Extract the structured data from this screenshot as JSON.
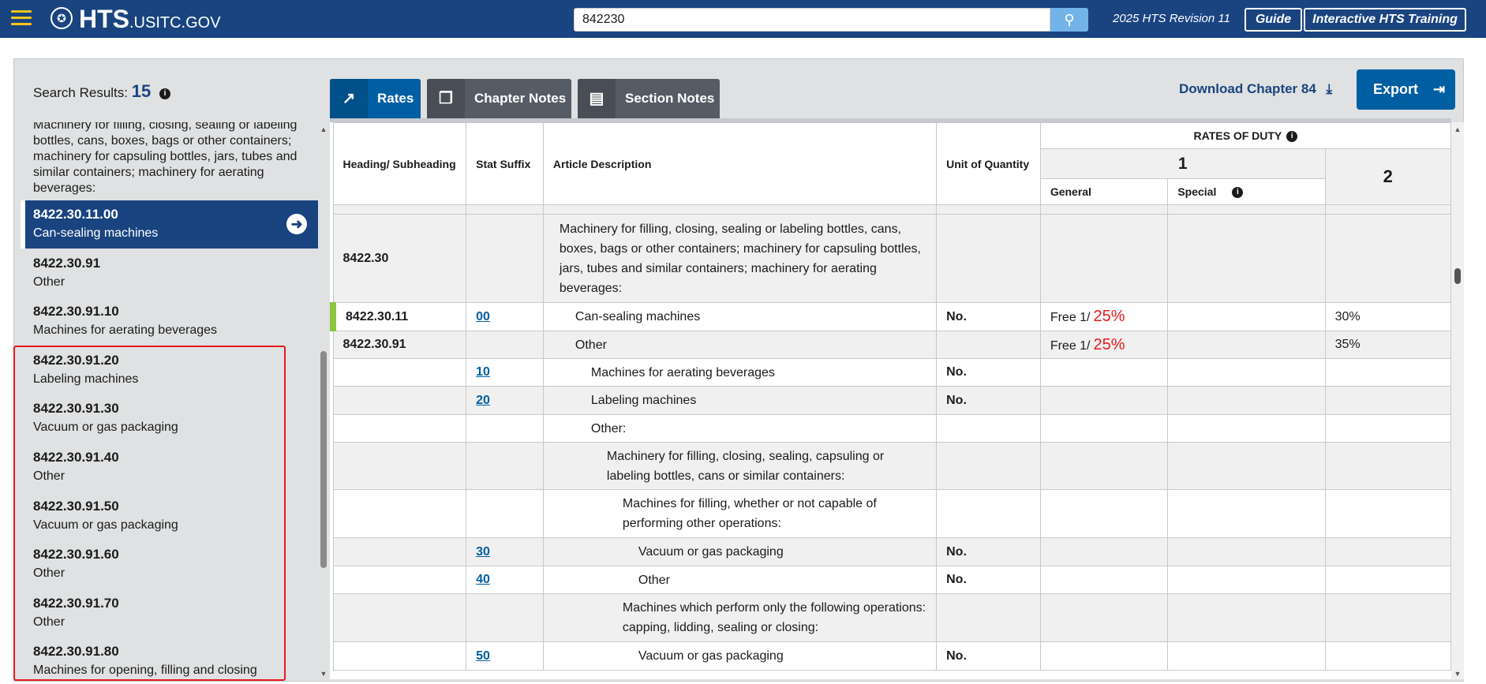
{
  "header": {
    "logo_main": "HTS",
    "logo_sub": ".USITC.GOV",
    "search_value": "842230",
    "revision": "2025 HTS Revision 11",
    "guide_label": "Guide",
    "training_label": "Interactive HTS Training"
  },
  "results": {
    "label": "Search Results:",
    "count": "15"
  },
  "tabs": [
    {
      "label": "Rates"
    },
    {
      "label": "Chapter Notes"
    },
    {
      "label": "Section Notes"
    }
  ],
  "download_label": "Download Chapter 84",
  "export_label": "Export",
  "sidebar": {
    "parent_desc": "Machinery for filling, closing, sealing or labeling bottles, cans, boxes, bags or other containers; machinery for capsuling bottles, jars, tubes and similar containers; machinery for aerating beverages:",
    "items": [
      {
        "code": "8422.30.11.00",
        "desc": "Can-sealing machines"
      },
      {
        "code": "8422.30.91",
        "desc": "Other"
      },
      {
        "code": "8422.30.91.10",
        "desc": "Machines for aerating beverages"
      },
      {
        "code": "8422.30.91.20",
        "desc": "Labeling machines"
      },
      {
        "code": "8422.30.91.30",
        "desc": "Vacuum or gas packaging"
      },
      {
        "code": "8422.30.91.40",
        "desc": "Other"
      },
      {
        "code": "8422.30.91.50",
        "desc": "Vacuum or gas packaging"
      },
      {
        "code": "8422.30.91.60",
        "desc": "Other"
      },
      {
        "code": "8422.30.91.70",
        "desc": "Other"
      },
      {
        "code": "8422.30.91.80",
        "desc": "Machines for opening, filling and closing"
      }
    ]
  },
  "table": {
    "headers": {
      "heading": "Heading/ Subheading",
      "stat": "Stat Suffix",
      "desc": "Article Description",
      "unit": "Unit of Quantity",
      "rates": "RATES OF DUTY",
      "col1": "1",
      "general": "General",
      "special": "Special",
      "col2": "2"
    },
    "rows": [
      {
        "heading": "8422.30",
        "stat": "",
        "desc": "Machinery for filling, closing, sealing or labeling bottles, cans, boxes, bags or other containers; machinery for capsuling bottles, jars, tubes and similar containers; machinery for aerating beverages:",
        "unit": "",
        "general": "",
        "added": "",
        "special": "",
        "col2": ""
      },
      {
        "heading": "8422.30.11",
        "stat": "00",
        "desc": "Can-sealing machines",
        "unit": "No.",
        "general": "Free 1/",
        "added": "25%",
        "special": "",
        "col2": "30%"
      },
      {
        "heading": "8422.30.91",
        "stat": "",
        "desc": "Other",
        "unit": "",
        "general": "Free 1/",
        "added": "25%",
        "special": "",
        "col2": "35%"
      },
      {
        "heading": "",
        "stat": "10",
        "desc": "Machines for aerating beverages",
        "unit": "No.",
        "general": "",
        "added": "",
        "special": "",
        "col2": ""
      },
      {
        "heading": "",
        "stat": "20",
        "desc": "Labeling machines",
        "unit": "No.",
        "general": "",
        "added": "",
        "special": "",
        "col2": ""
      },
      {
        "heading": "",
        "stat": "",
        "desc": "Other:",
        "unit": "",
        "general": "",
        "added": "",
        "special": "",
        "col2": ""
      },
      {
        "heading": "",
        "stat": "",
        "desc": "Machinery for filling, closing, sealing, capsuling or labeling bottles, cans or similar containers:",
        "unit": "",
        "general": "",
        "added": "",
        "special": "",
        "col2": ""
      },
      {
        "heading": "",
        "stat": "",
        "desc": "Machines for filling, whether or not capable of performing other operations:",
        "unit": "",
        "general": "",
        "added": "",
        "special": "",
        "col2": ""
      },
      {
        "heading": "",
        "stat": "30",
        "desc": "Vacuum or gas packaging",
        "unit": "No.",
        "general": "",
        "added": "",
        "special": "",
        "col2": ""
      },
      {
        "heading": "",
        "stat": "40",
        "desc": "Other",
        "unit": "No.",
        "general": "",
        "added": "",
        "special": "",
        "col2": ""
      },
      {
        "heading": "",
        "stat": "",
        "desc": "Machines which perform only the following operations: capping, lidding, sealing or closing:",
        "unit": "",
        "general": "",
        "added": "",
        "special": "",
        "col2": ""
      },
      {
        "heading": "",
        "stat": "50",
        "desc": "Vacuum or gas packaging",
        "unit": "No.",
        "general": "",
        "added": "",
        "special": "",
        "col2": ""
      }
    ]
  },
  "colors": {
    "header_bg": "#1a4480",
    "accent_yellow": "#f5c518",
    "highlight_red": "#e8191c",
    "green_marker": "#8cc63f"
  },
  "icons": [
    "menu-icon",
    "seal-icon",
    "search-icon",
    "info-icon",
    "rates-icon",
    "chapter-notes-icon",
    "section-notes-icon",
    "download-icon",
    "export-icon",
    "arrow-right-icon"
  ]
}
